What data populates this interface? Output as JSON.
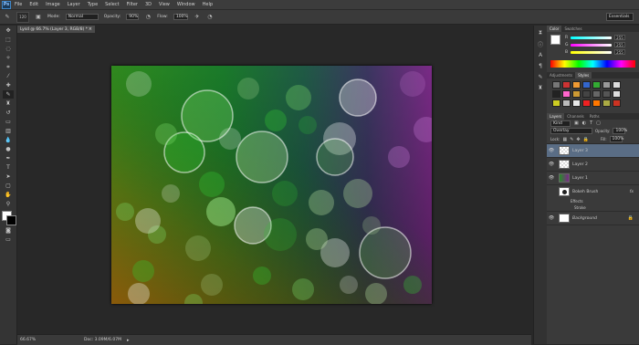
{
  "app": {
    "logo": "Ps"
  },
  "menu": [
    "File",
    "Edit",
    "Image",
    "Layer",
    "Type",
    "Select",
    "Filter",
    "3D",
    "View",
    "Window",
    "Help"
  ],
  "options": {
    "brush_size": "120",
    "mode_label": "Mode:",
    "mode_value": "Normal",
    "opacity_label": "Opacity:",
    "opacity_value": "90%",
    "flow_label": "Flow:",
    "flow_value": "100%"
  },
  "workspace": "Essentials",
  "document": {
    "tab_title": "Lysd @ 66.7% (Layer 3, RGB/8) *",
    "close": "×"
  },
  "status": {
    "zoom": "66.67%",
    "doc_size": "Doc: 3.09M/6.07M"
  },
  "color_panel": {
    "tabs": [
      "Color",
      "Swatches"
    ],
    "sliders": [
      {
        "label": "R",
        "value": "255"
      },
      {
        "label": "G",
        "value": "255"
      },
      {
        "label": "B",
        "value": "255"
      }
    ]
  },
  "styles_panel": {
    "tabs": [
      "Adjustments",
      "Styles"
    ]
  },
  "layers_panel": {
    "tabs": [
      "Layers",
      "Channels",
      "Paths"
    ],
    "kind_label": "Kind",
    "blend_mode": "Overlay",
    "opacity_label": "Opacity:",
    "opacity_value": "100%",
    "lock_label": "Lock:",
    "fill_label": "Fill:",
    "fill_value": "100%",
    "layers": [
      {
        "name": "Layer 3"
      },
      {
        "name": "Layer 2"
      },
      {
        "name": "Layer 1"
      },
      {
        "name": "Bokeh Brush",
        "fx": "fx"
      }
    ],
    "effects_label": "Effects",
    "stroke_label": "Stroke",
    "background": "Background"
  },
  "colors": {
    "canvas_gradient": [
      "#1e8a1e",
      "#2d6e2c",
      "#225a4a",
      "#3a3a5a",
      "#8a2a8e",
      "#d18a12"
    ]
  }
}
